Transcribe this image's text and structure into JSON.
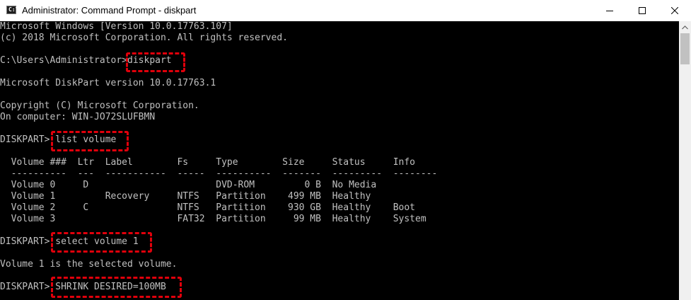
{
  "window": {
    "title": "Administrator: Command Prompt - diskpart",
    "icon_label": "C:\\"
  },
  "titlebar_buttons": {
    "minimize_icon": "minimize-icon",
    "maximize_icon": "maximize-icon",
    "close_icon": "close-icon"
  },
  "console": {
    "lines": [
      "Microsoft Windows [Version 10.0.17763.107]",
      "(c) 2018 Microsoft Corporation. All rights reserved.",
      "",
      "C:\\Users\\Administrator>diskpart",
      "",
      "Microsoft DiskPart version 10.0.17763.1",
      "",
      "Copyright (C) Microsoft Corporation.",
      "On computer: WIN-JO72SLUFBMN",
      "",
      "DISKPART> list volume",
      "",
      "  Volume ###  Ltr  Label        Fs     Type        Size     Status     Info",
      "  ----------  ---  -----------  -----  ----------  -------  ---------  --------",
      "  Volume 0     D                       DVD-ROM         0 B  No Media",
      "  Volume 1         Recovery     NTFS   Partition    499 MB  Healthy",
      "  Volume 2     C                NTFS   Partition    930 GB  Healthy    Boot",
      "  Volume 3                      FAT32  Partition     99 MB  Healthy    System",
      "",
      "DISKPART> select volume 1",
      "",
      "Volume 1 is the selected volume.",
      "",
      "DISKPART> SHRINK DESIRED=100MB"
    ]
  },
  "highlight_color": "#e0000b",
  "text_color": "#c0c0c0",
  "background_color": "#000000"
}
